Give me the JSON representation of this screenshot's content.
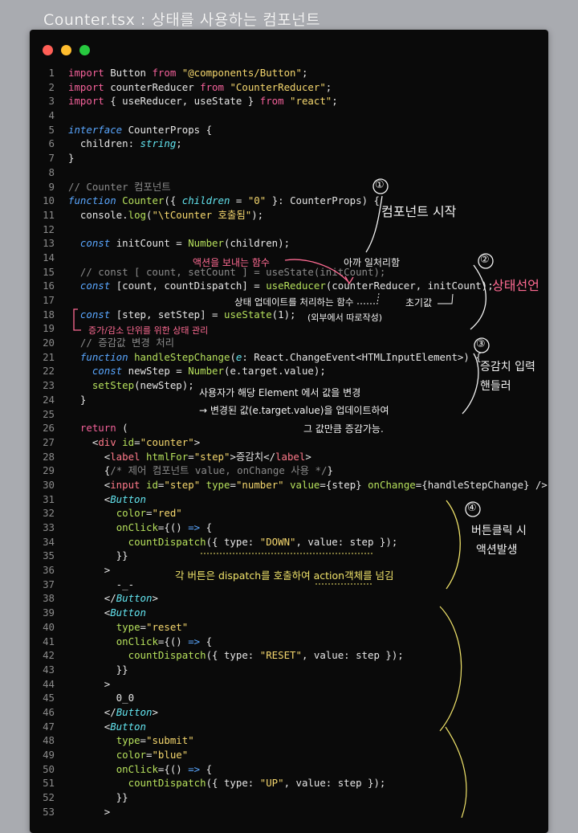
{
  "page_title": "Counter.tsx : 상태를 사용하는 컴포넌트",
  "code_lines": [
    {
      "n": "1",
      "t": [
        [
          "k",
          "import"
        ],
        [
          "v",
          " Button "
        ],
        [
          "k",
          "from"
        ],
        [
          "v",
          " "
        ],
        [
          "s",
          "\"@components/Button\""
        ],
        [
          "v",
          ";"
        ]
      ]
    },
    {
      "n": "2",
      "t": [
        [
          "k",
          "import"
        ],
        [
          "v",
          " counterReducer "
        ],
        [
          "k",
          "from"
        ],
        [
          "v",
          " "
        ],
        [
          "s",
          "\"CounterReducer\""
        ],
        [
          "v",
          ";"
        ]
      ]
    },
    {
      "n": "3",
      "t": [
        [
          "k",
          "import"
        ],
        [
          "v",
          " { useReducer, useState } "
        ],
        [
          "k",
          "from"
        ],
        [
          "v",
          " "
        ],
        [
          "s",
          "\"react\""
        ],
        [
          "v",
          ";"
        ]
      ]
    },
    {
      "n": "4",
      "t": []
    },
    {
      "n": "5",
      "t": [
        [
          "kf",
          "interface"
        ],
        [
          "v",
          " CounterProps {"
        ]
      ]
    },
    {
      "n": "6",
      "t": [
        [
          "v",
          "  children: "
        ],
        [
          "ti",
          "string"
        ],
        [
          "v",
          ";"
        ]
      ]
    },
    {
      "n": "7",
      "t": [
        [
          "v",
          "}"
        ]
      ]
    },
    {
      "n": "8",
      "t": []
    },
    {
      "n": "9",
      "t": [
        [
          "c",
          "// Counter 컴포넌트"
        ]
      ]
    },
    {
      "n": "10",
      "t": [
        [
          "kf",
          "function"
        ],
        [
          "v",
          " "
        ],
        [
          "f",
          "Counter"
        ],
        [
          "v",
          "({ "
        ],
        [
          "ti",
          "children"
        ],
        [
          "v",
          " = "
        ],
        [
          "s",
          "\"0\""
        ],
        [
          "v",
          " }: CounterProps) {"
        ]
      ]
    },
    {
      "n": "11",
      "t": [
        [
          "v",
          "  console."
        ],
        [
          "f",
          "log"
        ],
        [
          "v",
          "("
        ],
        [
          "s",
          "\"\\tCounter 호출됨\""
        ],
        [
          "v",
          ");"
        ]
      ]
    },
    {
      "n": "12",
      "t": []
    },
    {
      "n": "13",
      "t": [
        [
          "v",
          "  "
        ],
        [
          "kf",
          "const"
        ],
        [
          "v",
          " initCount = "
        ],
        [
          "f",
          "Number"
        ],
        [
          "v",
          "(children);"
        ]
      ]
    },
    {
      "n": "14",
      "t": []
    },
    {
      "n": "15",
      "t": [
        [
          "c",
          "  // const [ count, setCount ] = useState(initCount);"
        ]
      ]
    },
    {
      "n": "16",
      "t": [
        [
          "v",
          "  "
        ],
        [
          "kf",
          "const"
        ],
        [
          "v",
          " [count, countDispatch] = "
        ],
        [
          "f",
          "useReducer"
        ],
        [
          "v",
          "(counterReducer, initCount);"
        ]
      ]
    },
    {
      "n": "17",
      "t": []
    },
    {
      "n": "18",
      "t": [
        [
          "v",
          "  "
        ],
        [
          "kf",
          "const"
        ],
        [
          "v",
          " [step, setStep] = "
        ],
        [
          "f",
          "useState"
        ],
        [
          "v",
          "(1);"
        ]
      ]
    },
    {
      "n": "19",
      "t": []
    },
    {
      "n": "20",
      "t": [
        [
          "c",
          "  // 증감값 변경 처리"
        ]
      ]
    },
    {
      "n": "21",
      "t": [
        [
          "v",
          "  "
        ],
        [
          "kf",
          "function"
        ],
        [
          "v",
          " "
        ],
        [
          "f",
          "handleStepChange"
        ],
        [
          "v",
          "("
        ],
        [
          "ti",
          "e"
        ],
        [
          "v",
          ": React.ChangeEvent<HTMLInputElement>) {"
        ]
      ]
    },
    {
      "n": "22",
      "t": [
        [
          "v",
          "    "
        ],
        [
          "kf",
          "const"
        ],
        [
          "v",
          " newStep = "
        ],
        [
          "f",
          "Number"
        ],
        [
          "v",
          "(e.target.value);"
        ]
      ]
    },
    {
      "n": "23",
      "t": [
        [
          "v",
          "    "
        ],
        [
          "f",
          "setStep"
        ],
        [
          "v",
          "(newStep);"
        ]
      ]
    },
    {
      "n": "24",
      "t": [
        [
          "v",
          "  }"
        ]
      ]
    },
    {
      "n": "25",
      "t": []
    },
    {
      "n": "26",
      "t": [
        [
          "v",
          "  "
        ],
        [
          "k",
          "return"
        ],
        [
          "v",
          " ("
        ]
      ]
    },
    {
      "n": "27",
      "t": [
        [
          "v",
          "    <"
        ],
        [
          "tag",
          "div"
        ],
        [
          "v",
          " "
        ],
        [
          "f",
          "id"
        ],
        [
          "v",
          "="
        ],
        [
          "s",
          "\"counter\""
        ],
        [
          "v",
          ">"
        ]
      ]
    },
    {
      "n": "28",
      "t": [
        [
          "v",
          "      <"
        ],
        [
          "tag",
          "label"
        ],
        [
          "v",
          " "
        ],
        [
          "f",
          "htmlFor"
        ],
        [
          "v",
          "="
        ],
        [
          "s",
          "\"step\""
        ],
        [
          "v",
          ">증감치</"
        ],
        [
          "tag",
          "label"
        ],
        [
          "v",
          ">"
        ]
      ]
    },
    {
      "n": "29",
      "t": [
        [
          "v",
          "      {"
        ],
        [
          "c",
          "/* 제어 컴포넌트 value, onChange 사용 */"
        ],
        [
          "v",
          "}"
        ]
      ]
    },
    {
      "n": "30",
      "t": [
        [
          "v",
          "      <"
        ],
        [
          "tag",
          "input"
        ],
        [
          "v",
          " "
        ],
        [
          "f",
          "id"
        ],
        [
          "v",
          "="
        ],
        [
          "s",
          "\"step\""
        ],
        [
          "v",
          " "
        ],
        [
          "f",
          "type"
        ],
        [
          "v",
          "="
        ],
        [
          "s",
          "\"number\""
        ],
        [
          "v",
          " "
        ],
        [
          "f",
          "value"
        ],
        [
          "v",
          "={step} "
        ],
        [
          "f",
          "onChange"
        ],
        [
          "v",
          "={handleStepChange} />"
        ]
      ]
    },
    {
      "n": "31",
      "t": [
        [
          "v",
          "      <"
        ],
        [
          "ti",
          "Button"
        ]
      ]
    },
    {
      "n": "32",
      "t": [
        [
          "v",
          "        "
        ],
        [
          "f",
          "color"
        ],
        [
          "v",
          "="
        ],
        [
          "s",
          "\"red\""
        ]
      ]
    },
    {
      "n": "33",
      "t": [
        [
          "v",
          "        "
        ],
        [
          "f",
          "onClick"
        ],
        [
          "v",
          "={() "
        ],
        [
          "kf",
          "=>"
        ],
        [
          "v",
          " {"
        ]
      ]
    },
    {
      "n": "34",
      "t": [
        [
          "v",
          "          "
        ],
        [
          "f",
          "countDispatch"
        ],
        [
          "v",
          "({ type: "
        ],
        [
          "s",
          "\"DOWN\""
        ],
        [
          "v",
          ", value: step });"
        ]
      ]
    },
    {
      "n": "35",
      "t": [
        [
          "v",
          "        }}"
        ]
      ]
    },
    {
      "n": "36",
      "t": [
        [
          "v",
          "      >"
        ]
      ]
    },
    {
      "n": "37",
      "t": [
        [
          "v",
          "        -_-"
        ]
      ]
    },
    {
      "n": "38",
      "t": [
        [
          "v",
          "      </"
        ],
        [
          "ti",
          "Button"
        ],
        [
          "v",
          ">"
        ]
      ]
    },
    {
      "n": "39",
      "t": [
        [
          "v",
          "      <"
        ],
        [
          "ti",
          "Button"
        ]
      ]
    },
    {
      "n": "40",
      "t": [
        [
          "v",
          "        "
        ],
        [
          "f",
          "type"
        ],
        [
          "v",
          "="
        ],
        [
          "s",
          "\"reset\""
        ]
      ]
    },
    {
      "n": "41",
      "t": [
        [
          "v",
          "        "
        ],
        [
          "f",
          "onClick"
        ],
        [
          "v",
          "={() "
        ],
        [
          "kf",
          "=>"
        ],
        [
          "v",
          " {"
        ]
      ]
    },
    {
      "n": "42",
      "t": [
        [
          "v",
          "          "
        ],
        [
          "f",
          "countDispatch"
        ],
        [
          "v",
          "({ type: "
        ],
        [
          "s",
          "\"RESET\""
        ],
        [
          "v",
          ", value: step });"
        ]
      ]
    },
    {
      "n": "43",
      "t": [
        [
          "v",
          "        }}"
        ]
      ]
    },
    {
      "n": "44",
      "t": [
        [
          "v",
          "      >"
        ]
      ]
    },
    {
      "n": "45",
      "t": [
        [
          "v",
          "        0_0"
        ]
      ]
    },
    {
      "n": "46",
      "t": [
        [
          "v",
          "      </"
        ],
        [
          "ti",
          "Button"
        ],
        [
          "v",
          ">"
        ]
      ]
    },
    {
      "n": "47",
      "t": [
        [
          "v",
          "      <"
        ],
        [
          "ti",
          "Button"
        ]
      ]
    },
    {
      "n": "48",
      "t": [
        [
          "v",
          "        "
        ],
        [
          "f",
          "type"
        ],
        [
          "v",
          "="
        ],
        [
          "s",
          "\"submit\""
        ]
      ]
    },
    {
      "n": "49",
      "t": [
        [
          "v",
          "        "
        ],
        [
          "f",
          "color"
        ],
        [
          "v",
          "="
        ],
        [
          "s",
          "\"blue\""
        ]
      ]
    },
    {
      "n": "50",
      "t": [
        [
          "v",
          "        "
        ],
        [
          "f",
          "onClick"
        ],
        [
          "v",
          "={() "
        ],
        [
          "kf",
          "=>"
        ],
        [
          "v",
          " {"
        ]
      ]
    },
    {
      "n": "51",
      "t": [
        [
          "v",
          "          "
        ],
        [
          "f",
          "countDispatch"
        ],
        [
          "v",
          "({ type: "
        ],
        [
          "s",
          "\"UP\""
        ],
        [
          "v",
          ", value: step });"
        ]
      ]
    },
    {
      "n": "52",
      "t": [
        [
          "v",
          "        }}"
        ]
      ]
    },
    {
      "n": "53",
      "t": [
        [
          "v",
          "      >"
        ]
      ]
    }
  ],
  "annotations": {
    "a1_num": "①",
    "a1_text": "컴포넌트 시작",
    "a2_num": "②",
    "a2_text": "상태선언",
    "a3_num": "③",
    "a3_line1": "증감치 입력",
    "a3_line2": "핸들러",
    "a4_num": "④",
    "a4_line1": "버튼클릭 시",
    "a4_line2": "액션발생",
    "note_action": "액션을 보내는 함수",
    "note_reducer": "상태 업데이트를 처리하는 함수",
    "note_reducer_sub": "(외부에서 따로작성)",
    "note_comment": "아까 일처리함",
    "note_init": "초기값",
    "note_step": "증가/감소 단위를 위한 상태 관리",
    "note_handler1": "사용자가 해당 Element 에서 값을 변경",
    "note_handler2": "→ 변경된 값(e.target.value)을 업데이트하여",
    "note_handler3": "그 값만큼 증감가능.",
    "note_dispatch": "각 버튼은 dispatch를 호출하여 action객체를 넘김"
  }
}
